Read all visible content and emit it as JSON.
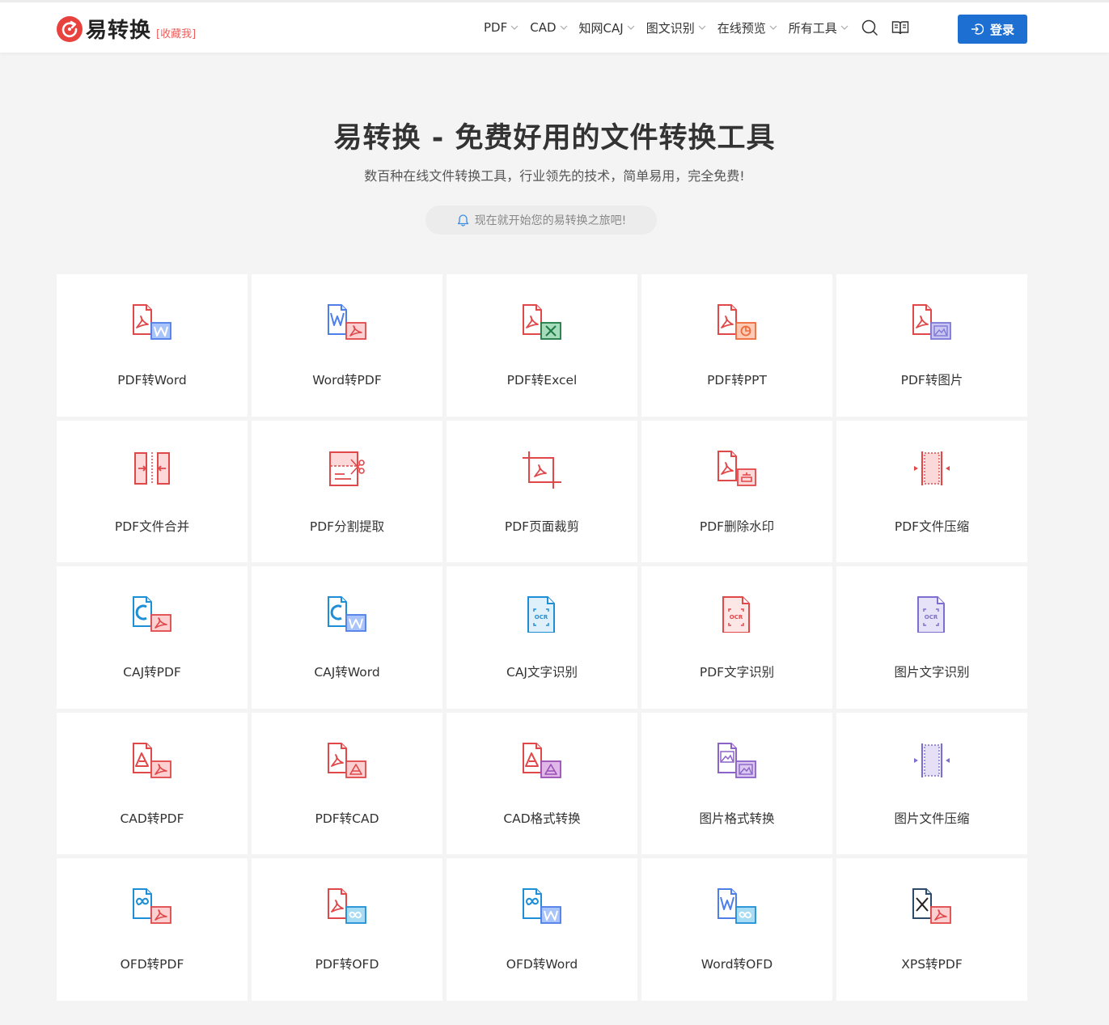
{
  "header": {
    "logo_text": "易转换",
    "logo_fav": "[收藏我]",
    "nav": [
      {
        "label": "PDF"
      },
      {
        "label": "CAD"
      },
      {
        "label": "知网CAJ"
      },
      {
        "label": "图文识别"
      },
      {
        "label": "在线预览"
      },
      {
        "label": "所有工具"
      }
    ],
    "login_label": "登录"
  },
  "hero": {
    "title": "易转换 - 免费好用的文件转换工具",
    "subtitle": "数百种在线文件转换工具，行业领先的技术，简单易用，完全免费!",
    "pill": "现在就开始您的易转换之旅吧!"
  },
  "colors": {
    "brand": "#e8423f",
    "primary": "#1e6fd2",
    "pdf_red": "#e0484a",
    "word_blue": "#4e7ee8",
    "excel_green": "#1e7a45",
    "ppt_orange": "#ee6a3b",
    "caj_blue": "#1e8fd6",
    "purple": "#8b63c9"
  },
  "tools": [
    {
      "label": "PDF转Word",
      "icon": "pdf-to-word-icon"
    },
    {
      "label": "Word转PDF",
      "icon": "word-to-pdf-icon"
    },
    {
      "label": "PDF转Excel",
      "icon": "pdf-to-excel-icon"
    },
    {
      "label": "PDF转PPT",
      "icon": "pdf-to-ppt-icon"
    },
    {
      "label": "PDF转图片",
      "icon": "pdf-to-image-icon"
    },
    {
      "label": "PDF文件合并",
      "icon": "pdf-merge-icon"
    },
    {
      "label": "PDF分割提取",
      "icon": "pdf-split-icon"
    },
    {
      "label": "PDF页面裁剪",
      "icon": "pdf-crop-icon"
    },
    {
      "label": "PDF删除水印",
      "icon": "pdf-remove-watermark-icon"
    },
    {
      "label": "PDF文件压缩",
      "icon": "pdf-compress-icon"
    },
    {
      "label": "CAJ转PDF",
      "icon": "caj-to-pdf-icon"
    },
    {
      "label": "CAJ转Word",
      "icon": "caj-to-word-icon"
    },
    {
      "label": "CAJ文字识别",
      "icon": "caj-ocr-icon"
    },
    {
      "label": "PDF文字识别",
      "icon": "pdf-ocr-icon"
    },
    {
      "label": "图片文字识别",
      "icon": "image-ocr-icon"
    },
    {
      "label": "CAD转PDF",
      "icon": "cad-to-pdf-icon"
    },
    {
      "label": "PDF转CAD",
      "icon": "pdf-to-cad-icon"
    },
    {
      "label": "CAD格式转换",
      "icon": "cad-convert-icon"
    },
    {
      "label": "图片格式转换",
      "icon": "image-convert-icon"
    },
    {
      "label": "图片文件压缩",
      "icon": "image-compress-icon"
    },
    {
      "label": "OFD转PDF",
      "icon": "ofd-to-pdf-icon"
    },
    {
      "label": "PDF转OFD",
      "icon": "pdf-to-ofd-icon"
    },
    {
      "label": "OFD转Word",
      "icon": "ofd-to-word-icon"
    },
    {
      "label": "Word转OFD",
      "icon": "word-to-ofd-icon"
    },
    {
      "label": "XPS转PDF",
      "icon": "xps-to-pdf-icon"
    }
  ]
}
